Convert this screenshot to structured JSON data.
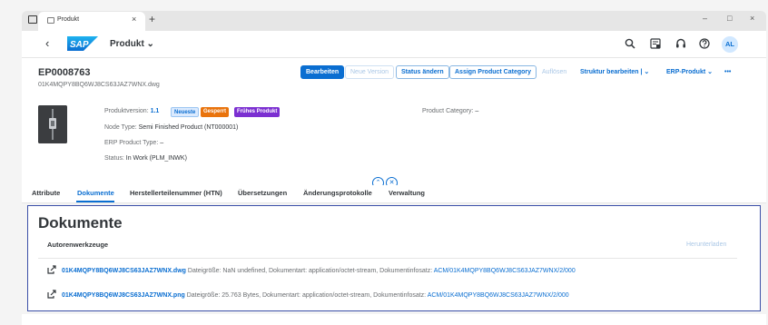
{
  "browser": {
    "tab_title": "Produkt",
    "close_glyph": "×",
    "new_tab_glyph": "+",
    "minimize_glyph": "–",
    "maximize_glyph": "□",
    "close_window_glyph": "×"
  },
  "shell": {
    "back_glyph": "‹",
    "app_title": "Produkt ⌄",
    "icons": [
      "search-icon",
      "notifications-icon",
      "headset-icon",
      "help-icon"
    ],
    "avatar_initials": "AL",
    "logo_text": "SAP"
  },
  "header": {
    "title": "EP0008763",
    "subtitle": "01K4MQPY8BQ6WJ8CS63JAZ7WNX.dwg",
    "actions": {
      "edit": "Bearbeiten",
      "new_version": "Neue Version",
      "change_status": "Status ändern",
      "assign_category": "Assign Product Category",
      "explode": "Auflösen",
      "edit_structure": "Struktur bearbeiten | ⌄",
      "erp_product": "ERP-Produkt ⌄",
      "more": "•••"
    },
    "fields": {
      "version_label": "Produktversion:",
      "version_value": "1.1",
      "node_type_label": "Node Type:",
      "node_type_value": "Semi Finished Product (NT000001)",
      "erp_type_label": "ERP Product Type:",
      "erp_type_value": "–",
      "status_label": "Status:",
      "status_value": "In Work (PLM_INWK)",
      "category_label": "Product Category:",
      "category_value": "–"
    },
    "badges": {
      "newest": "Neueste",
      "locked": "Gesperrt",
      "early": "Frühes Produkt"
    },
    "colors": {
      "newest_bg": "#dbeafe",
      "newest_fg": "#0a6ed1",
      "locked_bg": "#e9730c",
      "early_bg": "#7b2fd1"
    }
  },
  "tabs": [
    {
      "label": "Attribute"
    },
    {
      "label": "Dokumente"
    },
    {
      "label": "Herstellerteilenummer (HTN)"
    },
    {
      "label": "Übersetzungen"
    },
    {
      "label": "Änderungsprotokolle"
    },
    {
      "label": "Verwaltung"
    }
  ],
  "documents": {
    "title": "Dokumente",
    "group_label": "Autorenwerkzeuge",
    "download_label": "Herunterladen",
    "rows": [
      {
        "file": "01K4MQPY8BQ6WJ8CS63JAZ7WNX.dwg",
        "meta": "Dateigröße: NaN undefined, Dokumentart: application/octet-stream, Dokumentinfosatz:",
        "link": "ACM/01K4MQPY8BQ6WJ8CS63JAZ7WNX/2/000"
      },
      {
        "file": "01K4MQPY8BQ6WJ8CS63JAZ7WNX.png",
        "meta": "Dateigröße: 25.763 Bytes, Dokumentart: application/octet-stream, Dokumentinfosatz:",
        "link": "ACM/01K4MQPY8BQ6WJ8CS63JAZ7WNX/2/000"
      }
    ]
  }
}
